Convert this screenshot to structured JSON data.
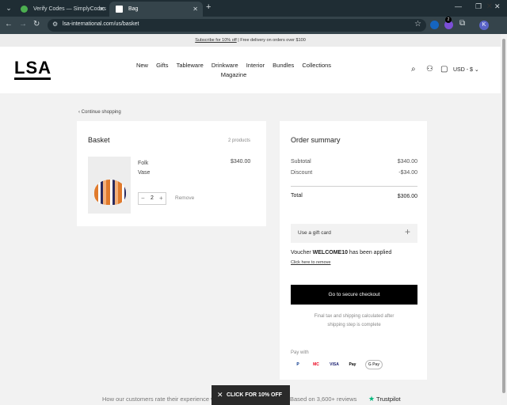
{
  "browser": {
    "tabs": [
      {
        "label": "Verify Codes — SimplyCodes",
        "close": "✕",
        "favicon_color": "#4caf50"
      },
      {
        "label": "Bag",
        "close": "✕",
        "favicon_color": "#ffffff"
      }
    ],
    "new_tab": "+",
    "window_controls": {
      "minimize": "—",
      "restore": "❐",
      "close": "✕"
    },
    "nav": {
      "back": "←",
      "forward": "→",
      "reload": "↻"
    },
    "url": "lsa-international.com/us/basket",
    "profile_initial": "K"
  },
  "promo": {
    "link_text": "Subscribe for 10% off",
    "rest": " | Free delivery on orders over $100",
    "close": "✕"
  },
  "header": {
    "logo": "LSA",
    "nav_items": [
      "New",
      "Gifts",
      "Tableware",
      "Drinkware",
      "Interior",
      "Bundles",
      "Collections",
      "Magazine"
    ],
    "bag_count": "2",
    "currency": "USD - $"
  },
  "continue_shopping": "Continue shopping",
  "basket": {
    "title": "Basket",
    "count": "2 products",
    "item": {
      "name_line1": "Folk",
      "name_line2": "Vase",
      "price": "$340.00",
      "quantity": "2",
      "minus": "−",
      "plus": "+",
      "remove": "Remove"
    }
  },
  "summary": {
    "title": "Order summary",
    "subtotal_label": "Subtotal",
    "subtotal": "$340.00",
    "discount_label": "Discount",
    "discount": "-$34.00",
    "total_label": "Total",
    "total": "$306.00",
    "gift_card": "Use a gift card",
    "gift_plus": "+",
    "voucher_prefix": "Voucher ",
    "voucher_code": "WELCOME10",
    "voucher_suffix": " has been applied",
    "voucher_remove": "Click here to remove",
    "checkout": "Go to secure checkout",
    "tax_note_line1": "Final tax and shipping calculated after",
    "tax_note_line2": "shipping step is complete",
    "pay_with": "Pay with",
    "payment_methods": [
      "P",
      "MC",
      "VISA",
      "Pay",
      "G Pay"
    ]
  },
  "footer": {
    "rate_text": "How our customers rate their experience w",
    "reviews_text": "Based on 3,600+ reviews",
    "trustpilot": "Trustpilot"
  },
  "popup": {
    "text": "CLICK FOR 10% OFF",
    "close": "✕"
  }
}
